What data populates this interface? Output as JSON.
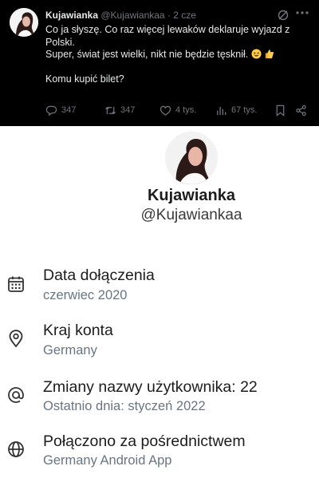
{
  "tweet": {
    "author_name": "Kujawianka",
    "author_handle": "@Kujawiankaa",
    "time": "· 2 cze",
    "lines": [
      "Co ja słyszę. Co raz więcej lewaków deklaruje wyjazd z Polski.",
      "Super, świat jest wielki, nikt nie będzie tęsknił.",
      "Komu kupić bilet?"
    ],
    "emoji": [
      "grinning-squinting-face",
      "thumbs-up"
    ],
    "actions": {
      "replies": "347",
      "reposts": "347",
      "likes": "4 tys.",
      "views": "67 tys."
    },
    "icons": [
      "grok-icon",
      "more-icon",
      "reply-icon",
      "repost-icon",
      "like-icon",
      "views-icon",
      "bookmark-icon",
      "share-icon"
    ]
  },
  "profile": {
    "name": "Kujawianka",
    "handle": "@Kujawiankaa",
    "rows": [
      {
        "icon": "calendar-icon",
        "title": "Data dołączenia",
        "subtitle": "czerwiec 2020"
      },
      {
        "icon": "location-pin-icon",
        "title": "Kraj konta",
        "subtitle": "Germany"
      },
      {
        "icon": "at-sign-icon",
        "title": "Zmiany nazwy użytkownika: 22",
        "subtitle": "Ostatnio dnia: styczeń 2022"
      },
      {
        "icon": "globe-icon",
        "title": "Połączono za pośrednictwem",
        "subtitle": "Germany Android App"
      }
    ]
  },
  "colors": {
    "tweet_background": "#000000",
    "tweet_text": "#e7e9ea",
    "muted": "#71767b",
    "profile_subtitle": "#687582"
  }
}
